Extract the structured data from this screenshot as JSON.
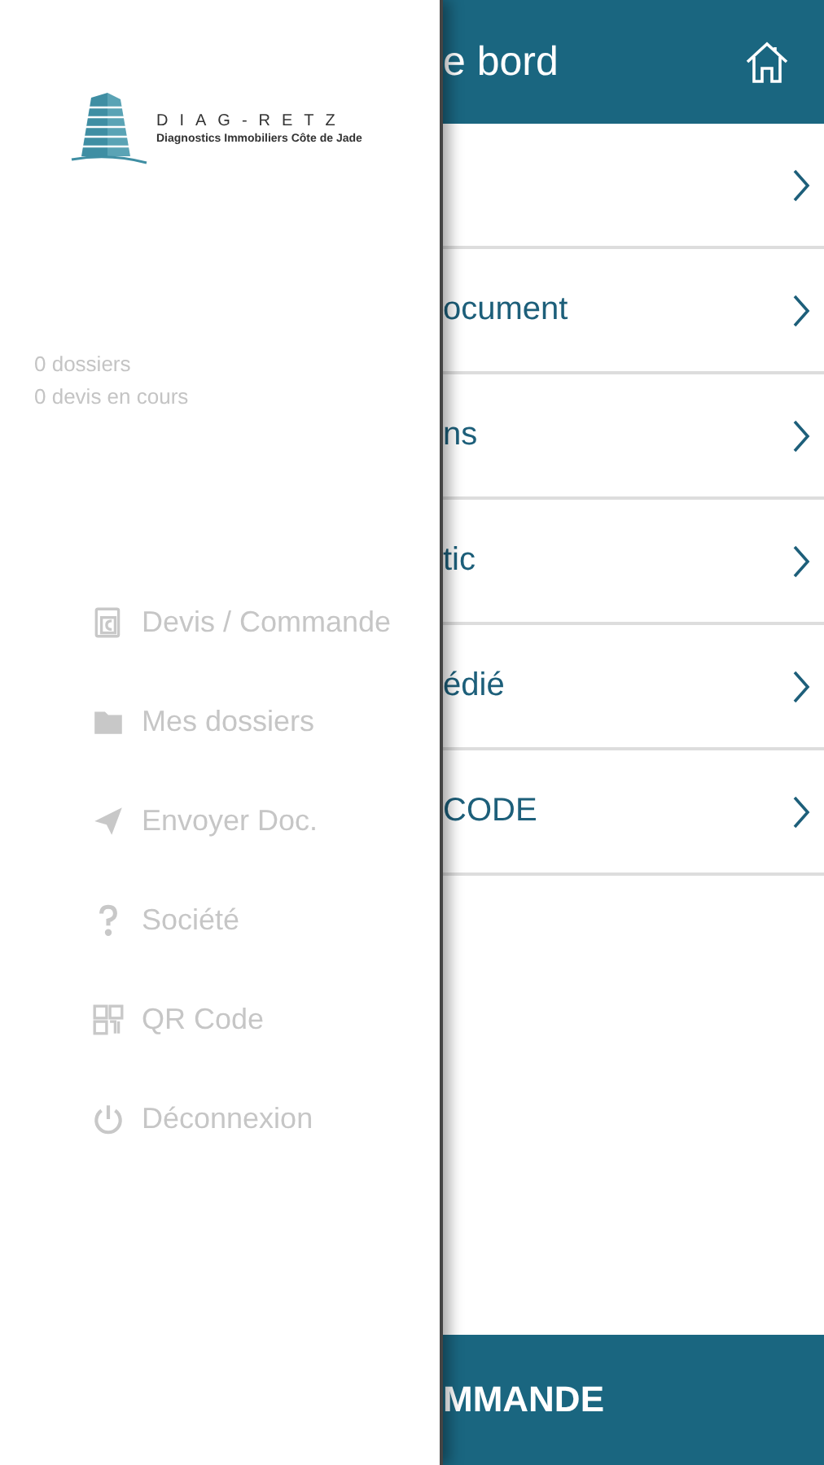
{
  "header": {
    "title": "e bord"
  },
  "list": [
    {
      "kind": "hidden"
    },
    {
      "kind": "text",
      "label": "ocument"
    },
    {
      "kind": "text",
      "label": "ns"
    },
    {
      "kind": "text",
      "label": "tic"
    },
    {
      "kind": "text",
      "label": "édié"
    },
    {
      "kind": "text",
      "label": "CODE"
    }
  ],
  "bottom_bar": {
    "label": "MMANDE"
  },
  "drawer": {
    "logo": {
      "name": "DIAG-RETZ",
      "tagline": "Diagnostics Immobiliers Côte de Jade"
    },
    "stats": [
      "0 dossiers",
      "0 devis en cours"
    ],
    "menu": [
      {
        "kind": "quote",
        "label": "Devis / Commande"
      },
      {
        "kind": "folder",
        "label": "Mes dossiers"
      },
      {
        "kind": "send",
        "label": "Envoyer Doc."
      },
      {
        "kind": "help",
        "label": "Société"
      },
      {
        "kind": "qr",
        "label": "QR Code"
      },
      {
        "kind": "power",
        "label": "Déconnexion"
      }
    ]
  }
}
